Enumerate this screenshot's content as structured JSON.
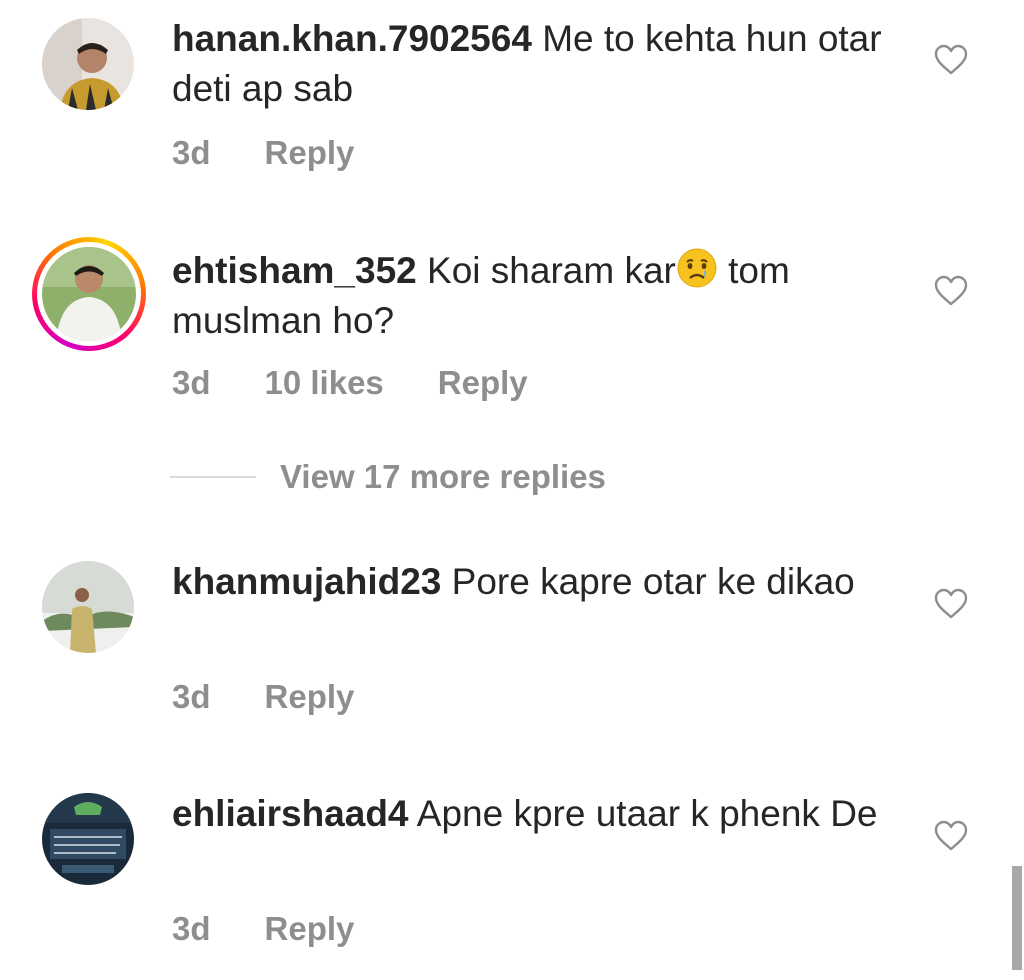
{
  "comments": [
    {
      "username": "hanan.khan.7902564",
      "text": "Me to kehta hun otar deti ap sab",
      "time": "3d",
      "likes": "",
      "reply_label": "Reply",
      "avatar": "profile-photo",
      "has_story_ring": false
    },
    {
      "username": "ehtisham_352",
      "text_before_emoji": "Koi sharam kar",
      "emoji": "crying-face",
      "text_after_emoji": " tom muslman ho?",
      "time": "3d",
      "likes": "10 likes",
      "reply_label": "Reply",
      "avatar": "profile-photo",
      "has_story_ring": true
    },
    {
      "username": "khanmujahid23",
      "text": "Pore kapre otar ke dikao",
      "time": "3d",
      "likes": "",
      "reply_label": "Reply",
      "avatar": "profile-photo",
      "has_story_ring": false
    },
    {
      "username": "ehliairshaad4",
      "text": "Apne kpre utaar k phenk De",
      "time": "3d",
      "likes": "",
      "reply_label": "Reply",
      "avatar": "profile-photo",
      "has_story_ring": false
    }
  ],
  "view_more_replies": "View 17 more replies",
  "icons": {
    "like": "heart-outline-icon"
  },
  "colors": {
    "text": "#262626",
    "secondary": "#8e8e8e",
    "divider": "#dbdbdb"
  }
}
